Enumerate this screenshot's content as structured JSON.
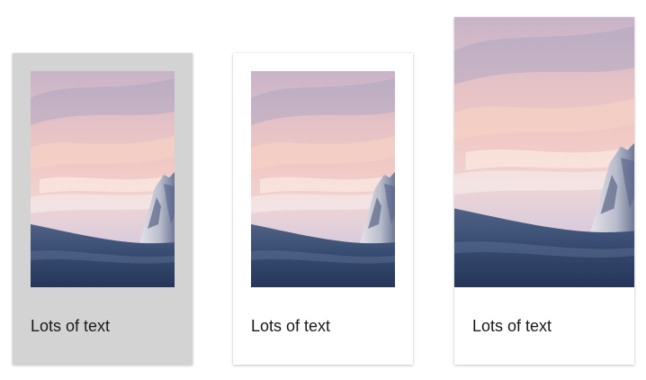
{
  "cards": [
    {
      "label": "Lots of text",
      "image": "snowy-mountain-sunset-photo",
      "state": "hovered"
    },
    {
      "label": "Lots of text",
      "image": "snowy-mountain-sunset-photo",
      "state": "default"
    },
    {
      "label": "Lots of text",
      "image": "snowy-mountain-sunset-photo",
      "state": "expanded"
    }
  ],
  "colors": {
    "page_background": "#ffffff",
    "hovered_card_background": "#d3d3d3",
    "card_background": "#ffffff",
    "text": "#1a1a1a"
  }
}
